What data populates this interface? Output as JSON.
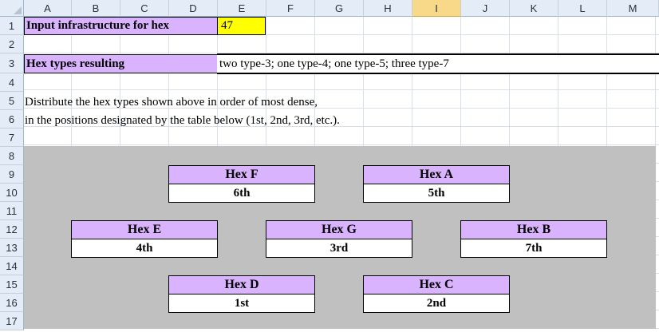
{
  "columns": [
    "A",
    "B",
    "C",
    "D",
    "E",
    "F",
    "G",
    "H",
    "I",
    "J",
    "K",
    "L",
    "M"
  ],
  "selected_column": "I",
  "rows": [
    "1",
    "2",
    "3",
    "4",
    "5",
    "6",
    "7",
    "8",
    "9",
    "10",
    "11",
    "12",
    "13",
    "14",
    "15",
    "16",
    "17"
  ],
  "input": {
    "label": "Input infrastructure for hex",
    "value": "47"
  },
  "result": {
    "label": "Hex types resulting",
    "value": "two type-3; one type-4; one type-5; three type-7"
  },
  "instructions": {
    "line1": "Distribute the hex types shown above in order of most dense,",
    "line2": "in the positions designated by the table below (1st, 2nd, 3rd, etc.)."
  },
  "hexes": [
    {
      "name": "Hex F",
      "rank": "6th"
    },
    {
      "name": "Hex A",
      "rank": "5th"
    },
    {
      "name": "Hex E",
      "rank": "4th"
    },
    {
      "name": "Hex G",
      "rank": "3rd"
    },
    {
      "name": "Hex B",
      "rank": "7th"
    },
    {
      "name": "Hex D",
      "rank": "1st"
    },
    {
      "name": "Hex C",
      "rank": "2nd"
    }
  ],
  "colors": {
    "label_fill": "#d9b3fe",
    "input_fill": "#ffff00",
    "grey_fill": "#c0c0c0",
    "header_fill": "#e4ecf7",
    "selected_header_fill": "#f8d889"
  }
}
